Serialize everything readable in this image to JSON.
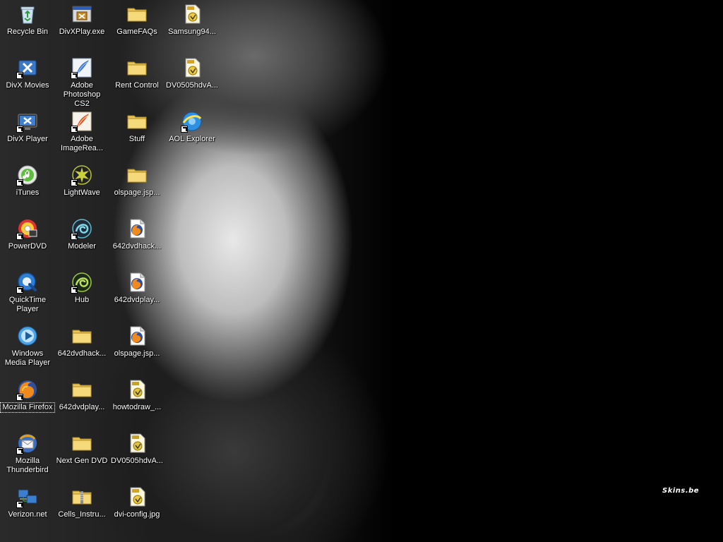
{
  "desktop": {
    "watermark": "Skins.be",
    "icons": [
      {
        "id": "recycle-bin",
        "label": "Recycle Bin",
        "icon": "recycle-bin-icon",
        "shortcut": false
      },
      {
        "id": "divx-movies",
        "label": "DivX Movies",
        "icon": "divx-icon",
        "shortcut": true
      },
      {
        "id": "divx-player",
        "label": "DivX Player",
        "icon": "divx-player-icon",
        "shortcut": true
      },
      {
        "id": "itunes",
        "label": "iTunes",
        "icon": "itunes-icon",
        "shortcut": true
      },
      {
        "id": "powerdvd",
        "label": "PowerDVD",
        "icon": "powerdvd-icon",
        "shortcut": true
      },
      {
        "id": "quicktime-player",
        "label": "QuickTime Player",
        "icon": "quicktime-icon",
        "shortcut": true
      },
      {
        "id": "windows-media-player",
        "label": "Windows Media Player",
        "icon": "windows-media-player-icon",
        "shortcut": false
      },
      {
        "id": "mozilla-firefox",
        "label": "Mozilla Firefox",
        "icon": "firefox-icon",
        "shortcut": true,
        "selected": true
      },
      {
        "id": "mozilla-thunderbird",
        "label": "Mozilla Thunderbird",
        "icon": "thunderbird-icon",
        "shortcut": true
      },
      {
        "id": "verizon-net",
        "label": "Verizon.net",
        "icon": "network-icon",
        "shortcut": true
      },
      {
        "id": "divxplay-exe",
        "label": "DivXPlay.exe",
        "icon": "application-icon",
        "shortcut": false
      },
      {
        "id": "adobe-photoshop-cs2",
        "label": "Adobe Photoshop CS2",
        "icon": "photoshop-icon",
        "shortcut": true
      },
      {
        "id": "adobe-imageready",
        "label": "Adobe ImageRea...",
        "icon": "imageready-icon",
        "shortcut": true
      },
      {
        "id": "lightwave",
        "label": "LightWave",
        "icon": "lightwave-icon",
        "shortcut": true
      },
      {
        "id": "modeler",
        "label": "Modeler",
        "icon": "modeler-icon",
        "shortcut": true
      },
      {
        "id": "hub",
        "label": "Hub",
        "icon": "hub-icon",
        "shortcut": true
      },
      {
        "id": "642dvdhack-folder",
        "label": "642dvdhack...",
        "icon": "folder-icon",
        "shortcut": false
      },
      {
        "id": "642dvdplay-folder",
        "label": "642dvdplay...",
        "icon": "folder-icon",
        "shortcut": false
      },
      {
        "id": "next-gen-dvd",
        "label": "Next Gen DVD",
        "icon": "folder-icon",
        "shortcut": false
      },
      {
        "id": "cells-instru",
        "label": "Cells_Instru...",
        "icon": "zip-folder-icon",
        "shortcut": false
      },
      {
        "id": "gamefaqs",
        "label": "GameFAQs",
        "icon": "folder-icon",
        "shortcut": false
      },
      {
        "id": "rent-control",
        "label": "Rent Control",
        "icon": "folder-icon",
        "shortcut": false
      },
      {
        "id": "stuff",
        "label": "Stuff",
        "icon": "folder-icon",
        "shortcut": false
      },
      {
        "id": "olspage-folder",
        "label": "olspage.jsp...",
        "icon": "folder-icon",
        "shortcut": false
      },
      {
        "id": "642dvdhack-html",
        "label": "642dvdhack...",
        "icon": "firefox-document-icon",
        "shortcut": false
      },
      {
        "id": "642dvdplay-html",
        "label": "642dvdplay...",
        "icon": "firefox-document-icon",
        "shortcut": false
      },
      {
        "id": "olspage-html",
        "label": "olspage.jsp...",
        "icon": "firefox-document-icon",
        "shortcut": false
      },
      {
        "id": "howtodraw",
        "label": "howtodraw_...",
        "icon": "gif-image-icon",
        "shortcut": false
      },
      {
        "id": "dv0505hdva-2",
        "label": "DV0505hdvA...",
        "icon": "gif-image-icon",
        "shortcut": false
      },
      {
        "id": "dvi-config",
        "label": "dvi-config.jpg",
        "icon": "jpg-image-icon",
        "shortcut": false
      },
      {
        "id": "samsung94",
        "label": "Samsung94...",
        "icon": "jpg-image-icon",
        "shortcut": false
      },
      {
        "id": "dv0505hdva-1",
        "label": "DV0505hdvA...",
        "icon": "jpg-image-icon",
        "shortcut": false
      },
      {
        "id": "aol-explorer",
        "label": "AOL Explorer",
        "icon": "aol-explorer-icon",
        "shortcut": true
      }
    ]
  }
}
